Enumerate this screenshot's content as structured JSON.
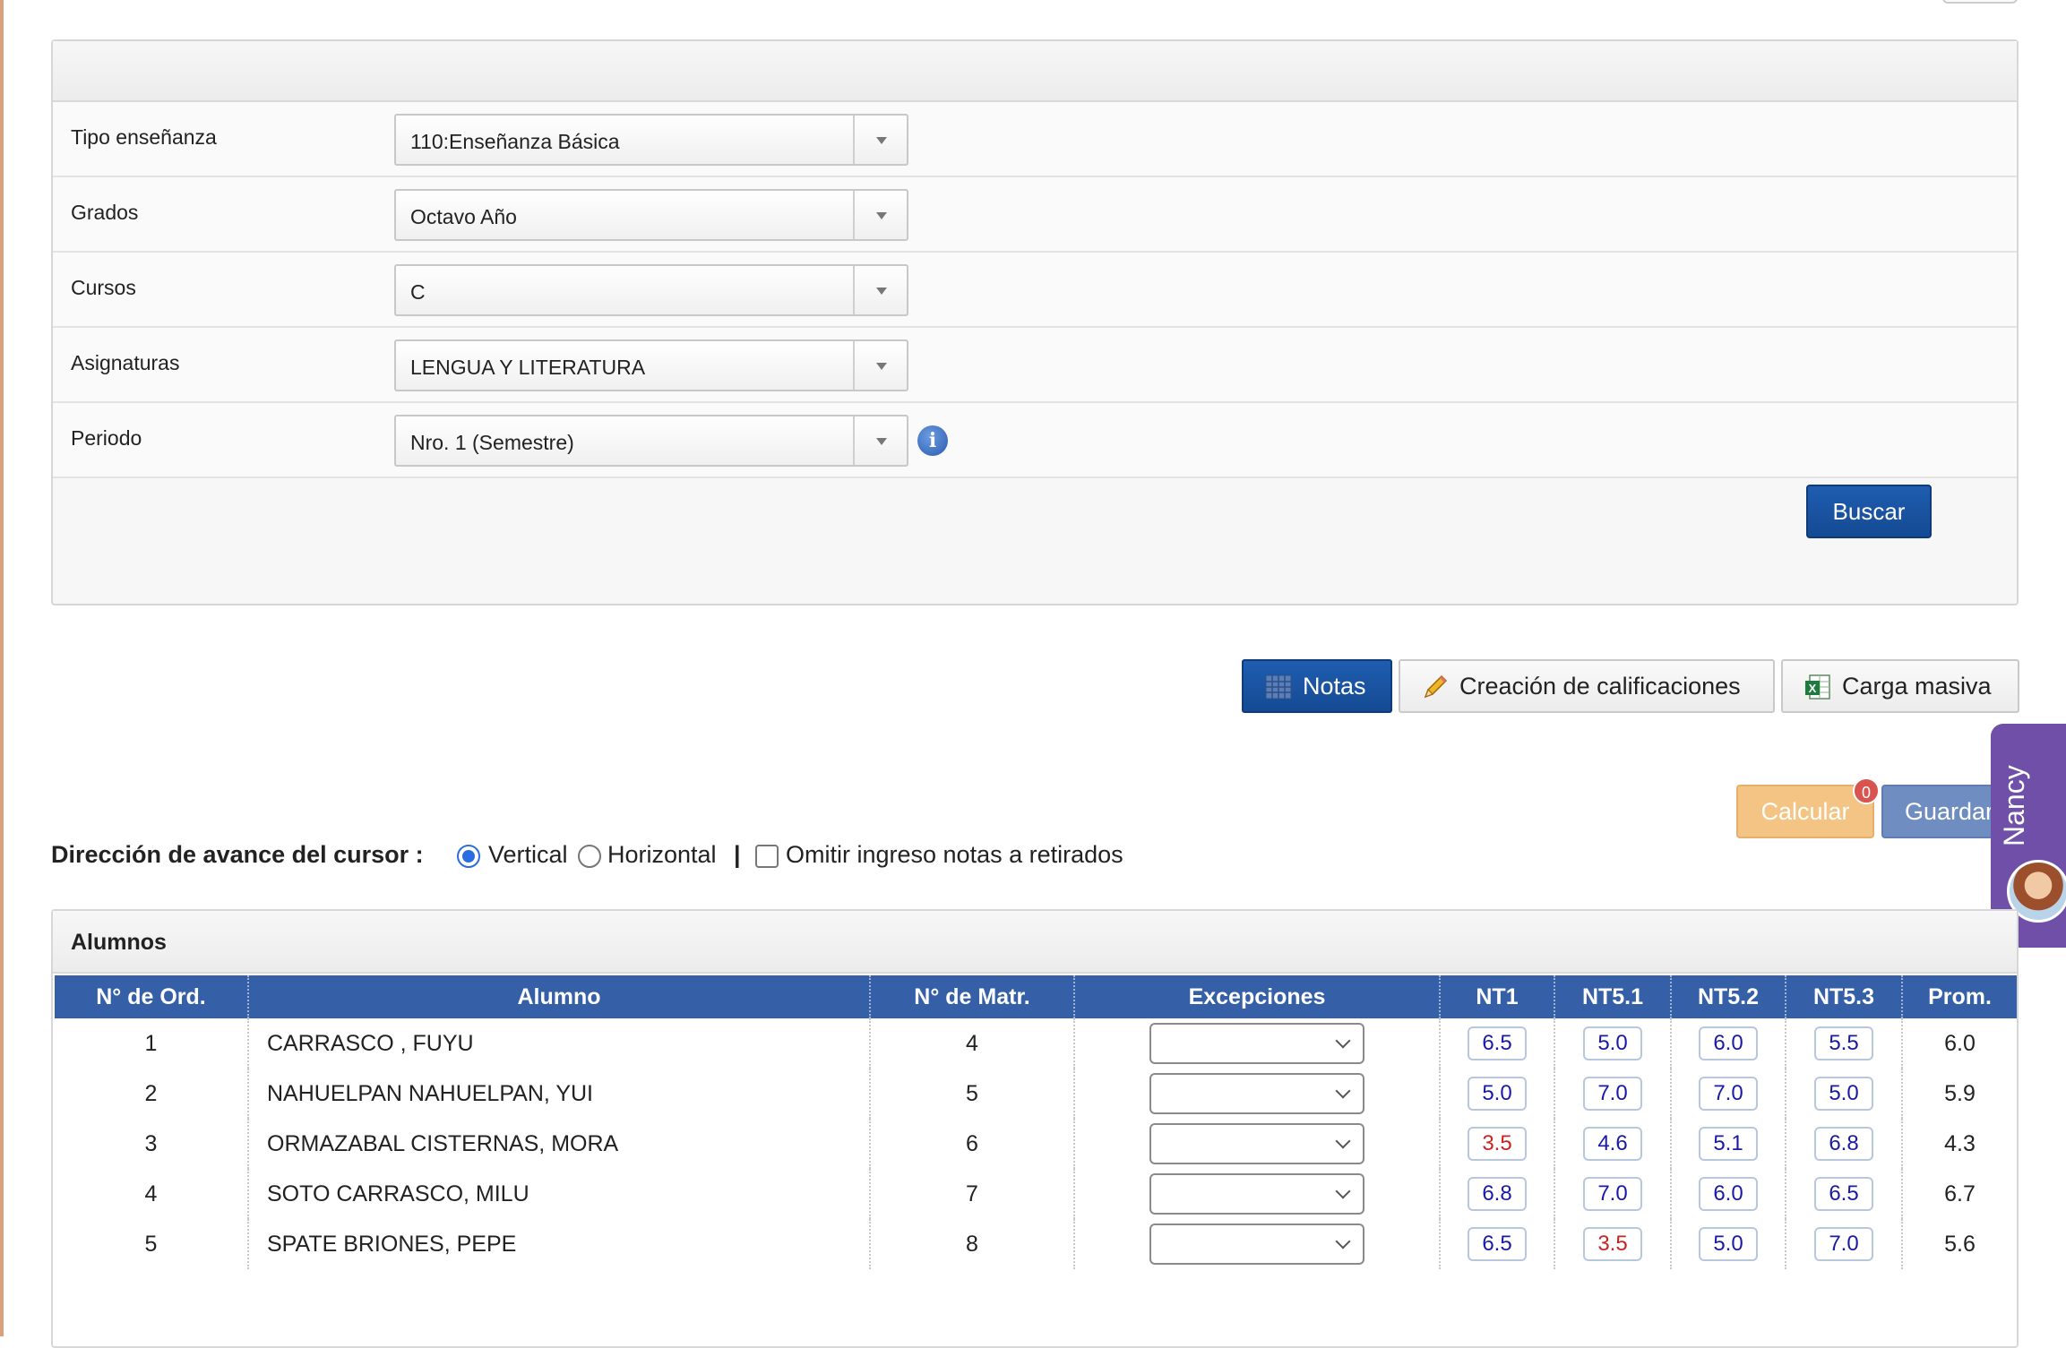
{
  "filters": {
    "rows": [
      {
        "label": "Tipo enseñanza",
        "value": "110:Enseñanza Básica"
      },
      {
        "label": "Grados",
        "value": "Octavo Año"
      },
      {
        "label": "Cursos",
        "value": "C"
      },
      {
        "label": "Asignaturas",
        "value": "LENGUA Y LITERATURA"
      },
      {
        "label": "Periodo",
        "value": "Nro. 1 (Semestre)"
      }
    ],
    "search_button": "Buscar"
  },
  "actions": {
    "notas": "Notas",
    "creacion": "Creación de calificaciones",
    "carga": "Carga masiva",
    "calcular": "Calcular",
    "calcular_badge": "0",
    "guardar": "Guardar"
  },
  "assistant": {
    "name": "Nancy",
    "accent": "#6f4fa8"
  },
  "cursor_direction": {
    "label": "Dirección de avance del cursor :",
    "vertical": "Vertical",
    "horizontal": "Horizontal",
    "separator": "|",
    "omit_label": "Omitir ingreso notas a retirados",
    "selected": "Vertical",
    "omit_checked": false
  },
  "alumnos": {
    "title": "Alumnos",
    "columns": [
      "N° de Ord.",
      "Alumno",
      "N° de Matr.",
      "Excepciones",
      "NT1",
      "NT5.1",
      "NT5.2",
      "NT5.3",
      "Prom."
    ],
    "rows": [
      {
        "ord": "1",
        "name": "CARRASCO , FUYU",
        "matr": "4",
        "grades": [
          "6.5",
          "5.0",
          "6.0",
          "5.5"
        ],
        "prom": "6.0"
      },
      {
        "ord": "2",
        "name": "NAHUELPAN NAHUELPAN, YUI",
        "matr": "5",
        "grades": [
          "5.0",
          "7.0",
          "7.0",
          "5.0"
        ],
        "prom": "5.9"
      },
      {
        "ord": "3",
        "name": "ORMAZABAL CISTERNAS, MORA",
        "matr": "6",
        "grades": [
          "3.5",
          "4.6",
          "5.1",
          "6.8"
        ],
        "prom": "4.3"
      },
      {
        "ord": "4",
        "name": "SOTO CARRASCO, MILU",
        "matr": "7",
        "grades": [
          "6.8",
          "7.0",
          "6.0",
          "6.5"
        ],
        "prom": "6.7"
      },
      {
        "ord": "5",
        "name": "SPATE BRIONES, PEPE",
        "matr": "8",
        "grades": [
          "6.5",
          "3.5",
          "5.0",
          "7.0"
        ],
        "prom": "5.6"
      }
    ]
  },
  "colors": {
    "primary": "#1f5db0",
    "table_header": "#355fa6",
    "grade_text": "#1a1aa8",
    "failing_grade": "#cc2222",
    "calcular": "#f3c483"
  }
}
